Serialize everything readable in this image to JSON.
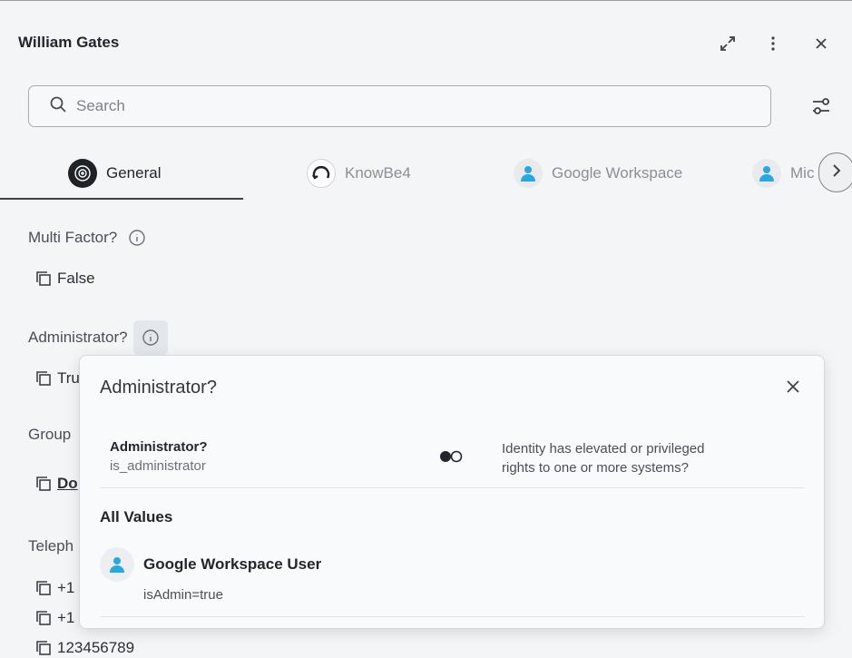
{
  "header": {
    "title": "William Gates"
  },
  "search": {
    "placeholder": "Search",
    "value": ""
  },
  "tabs": [
    {
      "label": "General",
      "icon": "target-icon",
      "active": true
    },
    {
      "label": "KnowBe4",
      "icon": "knowbe4-icon",
      "active": false
    },
    {
      "label": "Google Workspace",
      "icon": "user-icon",
      "active": false
    },
    {
      "label": "Mic",
      "icon": "user-icon",
      "active": false
    }
  ],
  "fields": {
    "multi_factor": {
      "label": "Multi Factor?",
      "value": "False"
    },
    "administrator": {
      "label": "Administrator?",
      "value": "Tru"
    },
    "group": {
      "label": "Group",
      "value": "Do"
    },
    "telephone": {
      "label": "Teleph",
      "values": [
        "+1",
        "+1",
        "123456789"
      ]
    }
  },
  "popover": {
    "title": "Administrator?",
    "attribute_name": "Administrator?",
    "attribute_key": "is_administrator",
    "description_line1": "Identity has elevated or privileged",
    "description_line2": "rights to one or more systems?",
    "all_values_heading": "All Values",
    "source": {
      "name": "Google Workspace User",
      "value": "isAdmin=true"
    }
  },
  "colors": {
    "background": "#f4f5f7",
    "accent_user": "#29a8e0",
    "text_primary": "#22262c",
    "text_muted": "#8a8f96"
  }
}
